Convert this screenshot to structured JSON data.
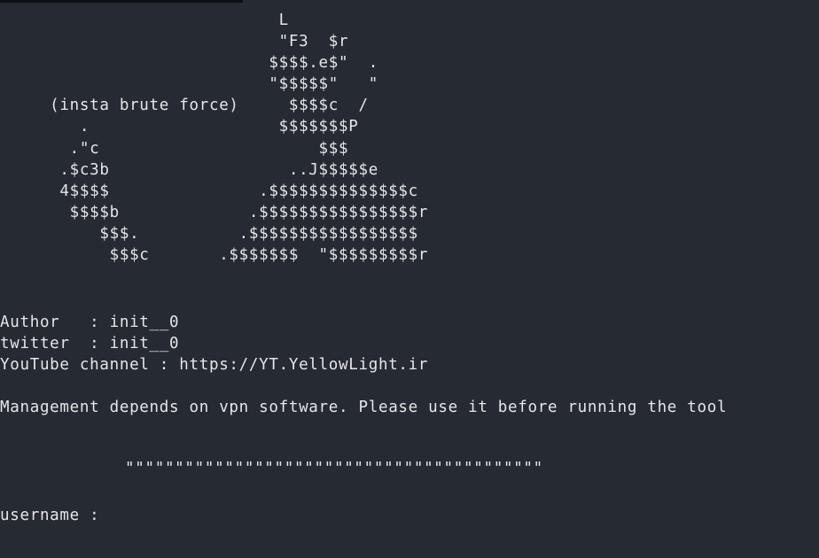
{
  "terminal": {
    "background": "#262a33",
    "foreground": "#e6e6e6",
    "ascii_art": "                            L\n                            \"F3  $r\n                           $$$$.e$\"  .\n                           \"$$$$$\"   \"\n     (insta brute force)     $$$$c  /\n        .                   $$$$$$$P\n       .\"c                      $$$\n      .$c3b                  ..J$$$$$e\n      4$$$$               .$$$$$$$$$$$$$$c\n       $$$$b             .$$$$$$$$$$$$$$$$r\n          $$$.          .$$$$$$$$$$$$$$$$$\n           $$$c       .$$$$$$$  \"$$$$$$$$$r",
    "author_line": "Author   : init__0",
    "twitter_line": "twitter  : init__0",
    "youtube_line": "YouTube channel : https://YT.YellowLight.ir",
    "notice_line": "Management depends on vpn software. Please use it before running the tool",
    "quote_divider": "\"\"\"\"\"\"\"\"\"\"\"\"\"\"\"\"\"\"\"\"\"\"\"\"\"\"\"\"\"\"\"\"\"\"\"\"\"\"\"\"\"\"",
    "prompt": "username : "
  }
}
